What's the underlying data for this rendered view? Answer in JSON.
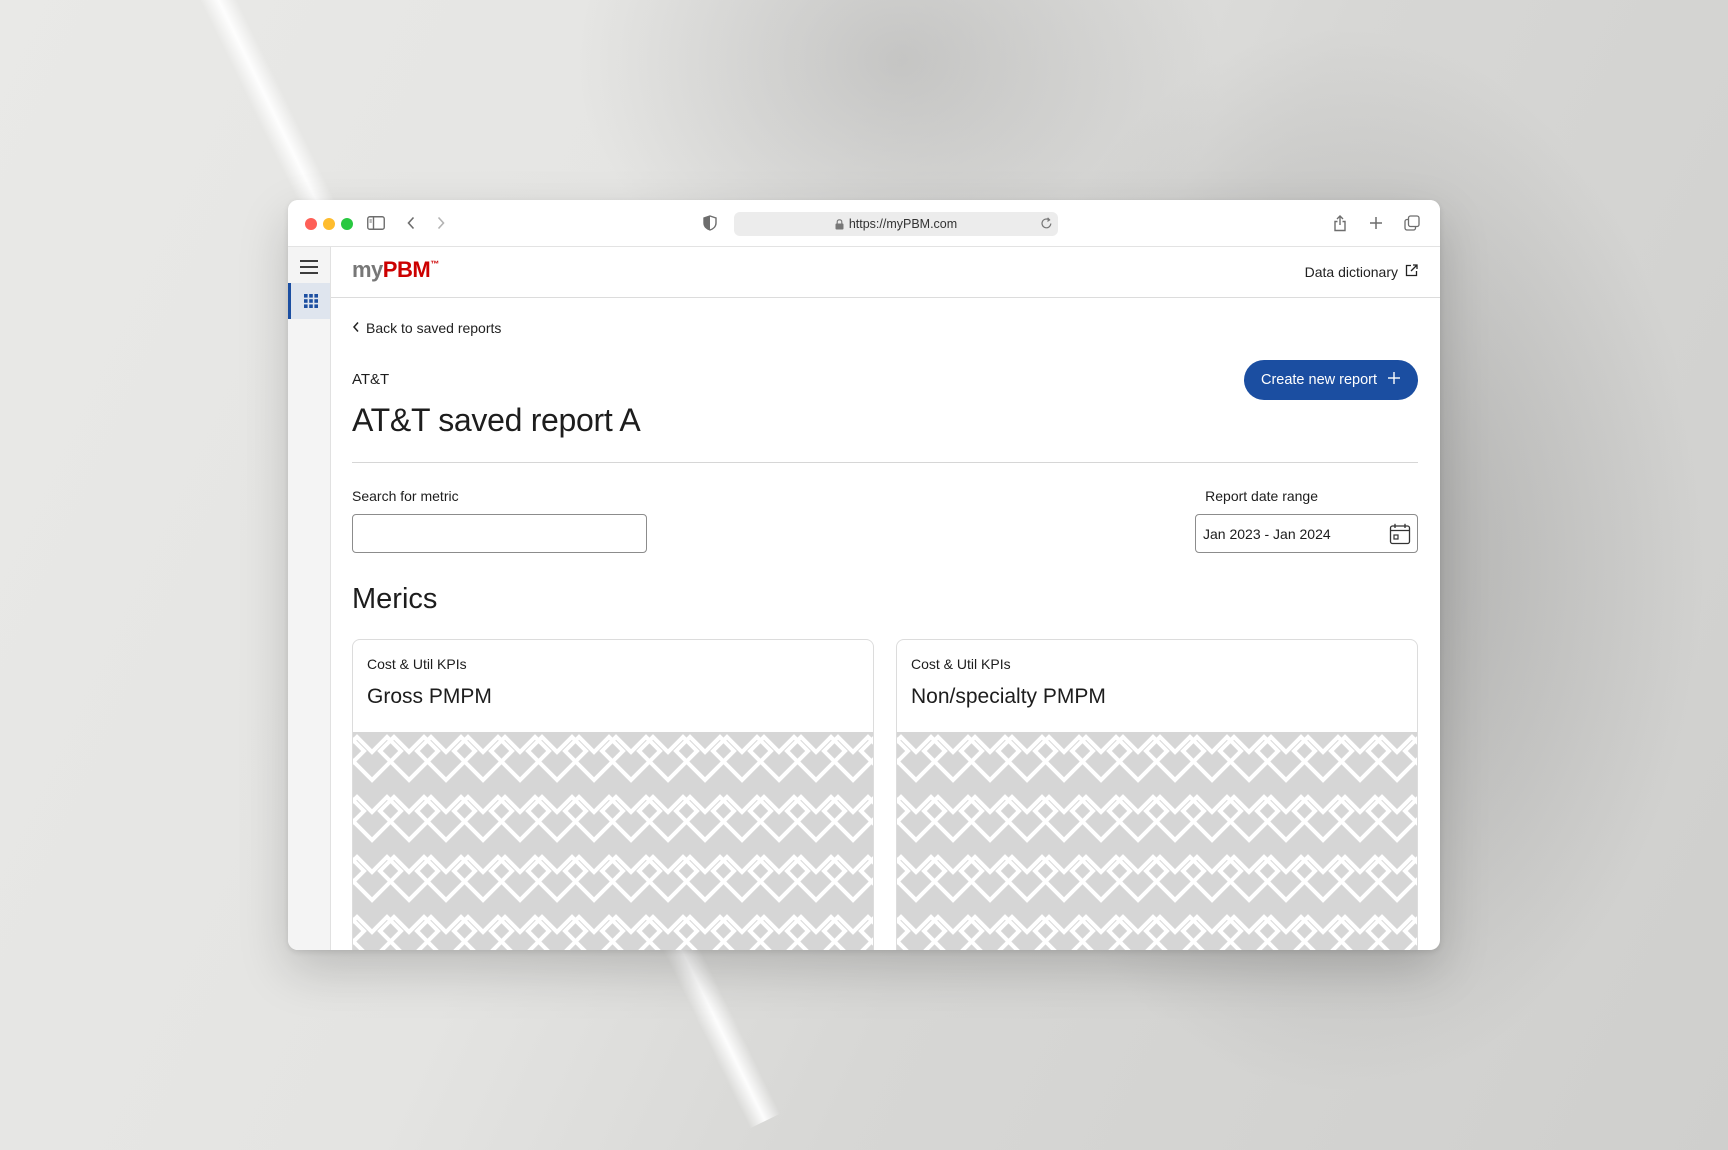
{
  "browser": {
    "url": "https://myPBM.com"
  },
  "app": {
    "logo_my": "my",
    "logo_pbm": "PBM",
    "logo_tm": "™",
    "data_dictionary_label": "Data dictionary"
  },
  "page": {
    "back_label": "Back to saved reports",
    "client": "AT&T",
    "title": "AT&T saved report A",
    "create_button_label": "Create new report",
    "search_label": "Search for metric",
    "search_value": "",
    "date_label": "Report date range",
    "date_value": "Jan 2023 - Jan 2024",
    "section_title": "Merics"
  },
  "cards": [
    {
      "category": "Cost & Util KPIs",
      "name": "Gross PMPM"
    },
    {
      "category": "Cost & Util KPIs",
      "name": "Non/specialty PMPM"
    }
  ],
  "colors": {
    "accent": "#1b4ea1",
    "brand_red": "#cc0000"
  },
  "icons": [
    "hamburger-menu-icon",
    "apps-grid-icon",
    "sidebar-toggle-icon",
    "back-chevron-icon",
    "forward-chevron-icon",
    "shield-icon",
    "lock-icon",
    "reload-icon",
    "share-icon",
    "new-tab-plus-icon",
    "tabs-overview-icon",
    "external-link-icon",
    "chevron-left-icon",
    "plus-icon",
    "calendar-icon"
  ]
}
